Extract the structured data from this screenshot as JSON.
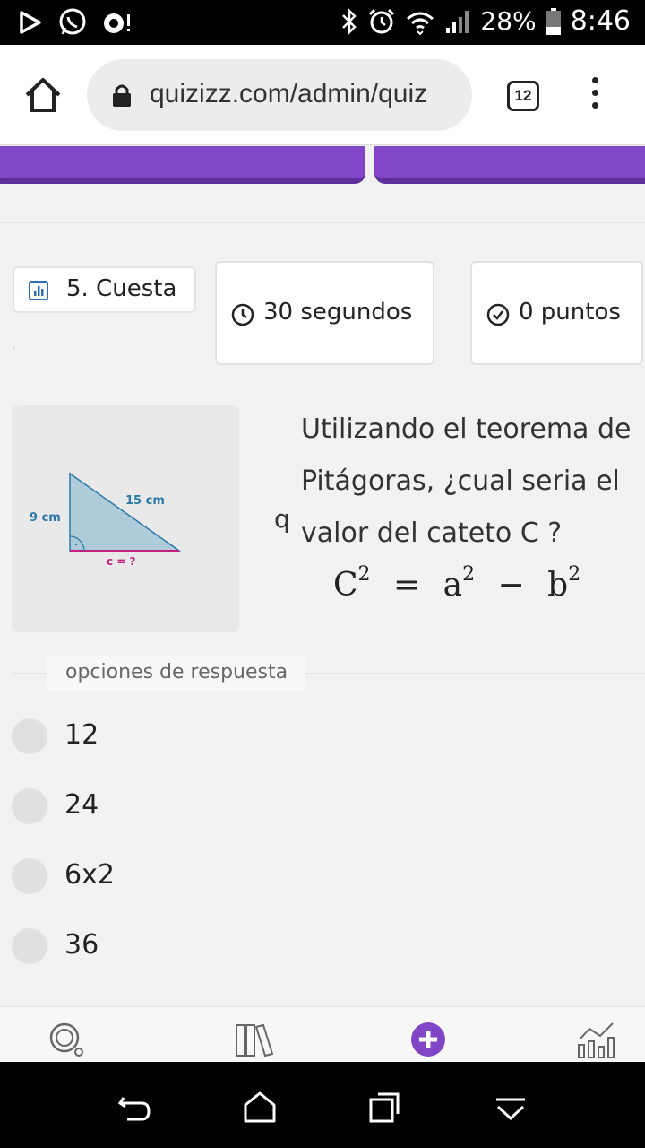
{
  "status_bar": {
    "battery": "28%",
    "time": "8:46",
    "icons": [
      "play-icon",
      "whatsapp-icon",
      "notification-icon",
      "bluetooth-icon",
      "alarm-icon",
      "wifi-icon",
      "signal-icon",
      "battery-icon"
    ]
  },
  "browser": {
    "url": "quizizz.com/admin/quiz",
    "tab_count": "12",
    "icons": [
      "home-icon",
      "lock-icon",
      "tabs-icon",
      "menu-icon"
    ]
  },
  "question": {
    "label": "5. Cuesta",
    "time": "30 segundos",
    "points": "0 puntos",
    "stray_char": "q",
    "text": "Utilizando el teorema de Pitágoras, ¿cual seria el valor del cateto C ?",
    "formula": {
      "lhs_base": "C",
      "lhs_exp": "2",
      "eq": "=",
      "a_base": "a",
      "a_exp": "2",
      "minus": "−",
      "b_base": "b",
      "b_exp": "2"
    },
    "image": {
      "side_a": "9 cm",
      "hypotenuse": "15 cm",
      "side_c": "c = ?"
    }
  },
  "answers": {
    "label": "opciones de respuesta",
    "options": [
      "12",
      "24",
      "6x2",
      "36"
    ]
  },
  "colors": {
    "purple": "#8146c7",
    "triangle_fill": "#aecbd9",
    "triangle_stroke": "#2a78a8",
    "magenta": "#c0217f"
  }
}
